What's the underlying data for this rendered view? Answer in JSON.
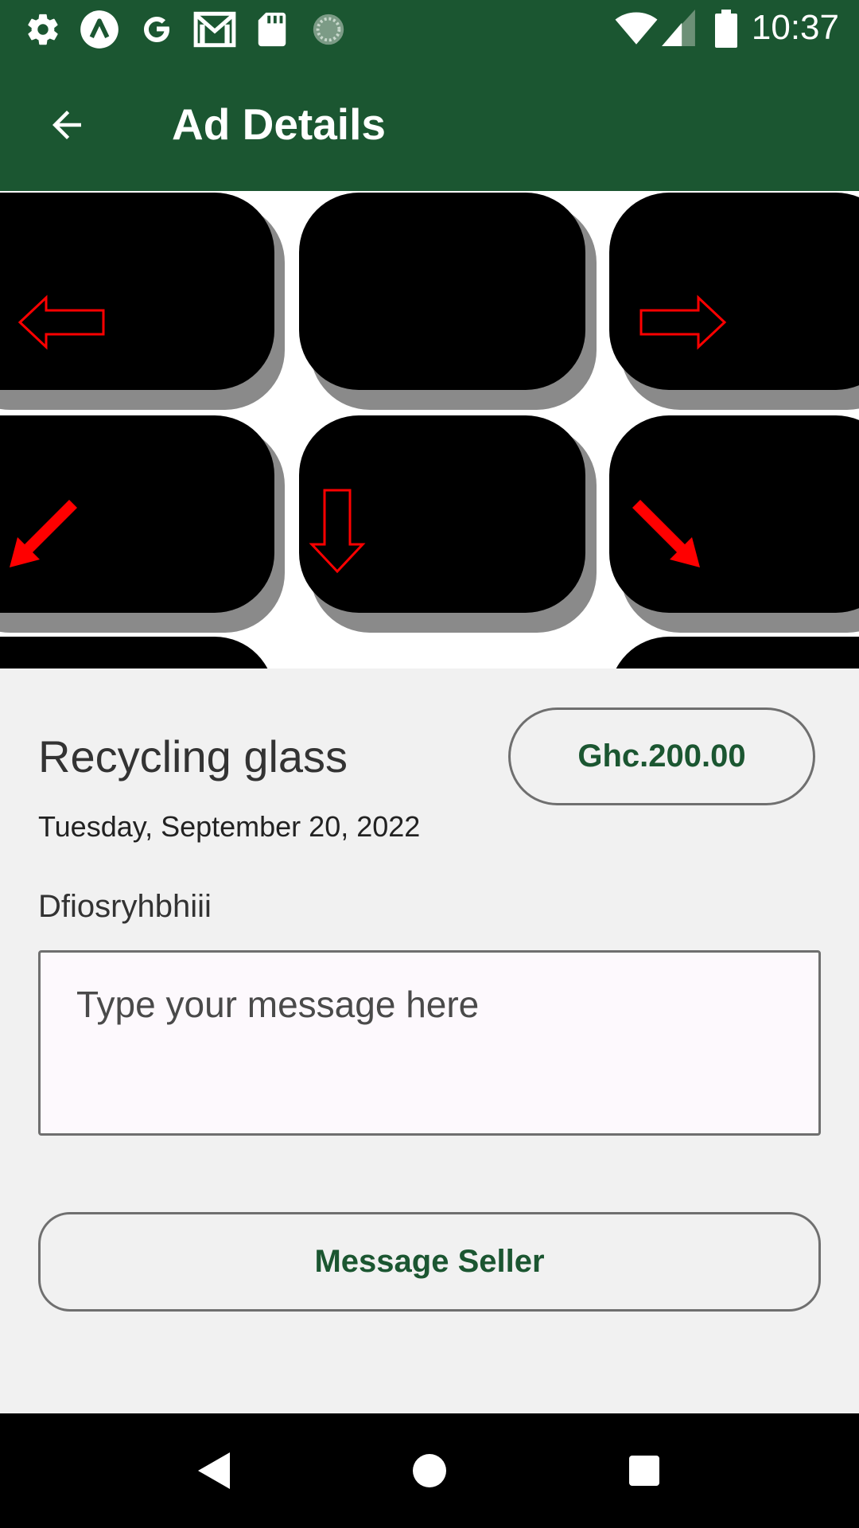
{
  "status_bar": {
    "time": "10:37",
    "left_icons": [
      "gear-icon",
      "a-circle-icon",
      "google-g-icon",
      "gmail-icon",
      "sd-card-icon",
      "loading-icon"
    ],
    "right_icons": [
      "wifi-icon",
      "cell-signal-icon",
      "battery-icon"
    ]
  },
  "app_bar": {
    "title": "Ad Details",
    "back_icon": "arrow-back-icon"
  },
  "ad": {
    "image_description_icons": [
      "arrow-left-icon",
      "arrow-right-icon",
      "arrow-down-left-icon",
      "arrow-down-icon",
      "arrow-down-right-icon"
    ],
    "title": "Recycling glass",
    "price": "Ghc.200.00",
    "date": "Tuesday, September 20, 2022",
    "description": "Dfiosryhbhiii"
  },
  "message": {
    "placeholder": "Type your message here",
    "value": ""
  },
  "actions": {
    "message_seller_label": "Message Seller"
  },
  "nav_bar": {
    "icons": [
      "back-triangle-icon",
      "home-circle-icon",
      "recents-square-icon"
    ]
  },
  "colors": {
    "primary": "#1b5631",
    "background": "#f1f1f1",
    "arrow_red": "#ff0000"
  }
}
